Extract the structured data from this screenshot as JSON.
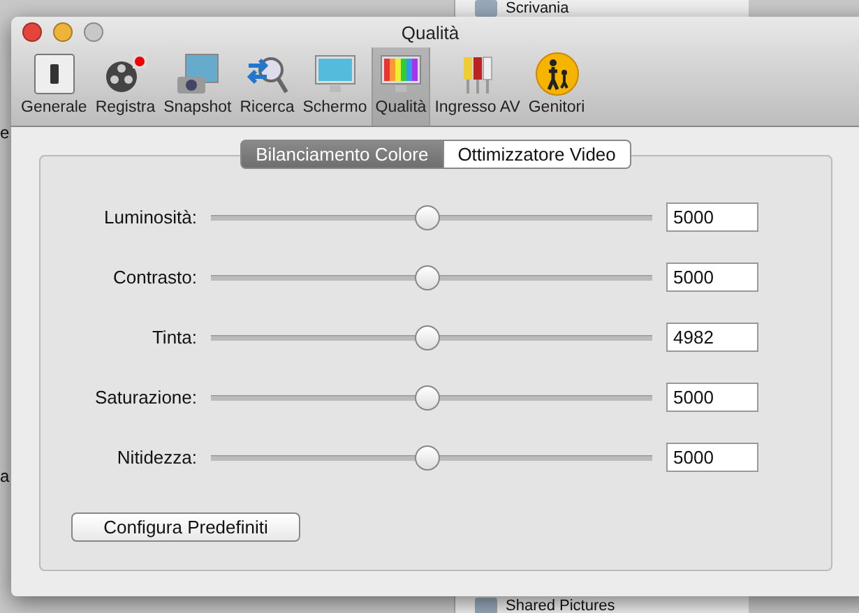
{
  "background": {
    "items": [
      "Scrivania",
      "Shared Pictures"
    ],
    "fragments": [
      "e",
      "a"
    ]
  },
  "window": {
    "title": "Qualità"
  },
  "toolbar": {
    "items": [
      {
        "label": "Generale",
        "selected": false
      },
      {
        "label": "Registra",
        "selected": false
      },
      {
        "label": "Snapshot",
        "selected": false
      },
      {
        "label": "Ricerca",
        "selected": false
      },
      {
        "label": "Schermo",
        "selected": false
      },
      {
        "label": "Qualità",
        "selected": true
      },
      {
        "label": "Ingresso AV",
        "selected": false
      },
      {
        "label": "Genitori",
        "selected": false
      }
    ]
  },
  "tabs": [
    {
      "label": "Bilanciamento Colore",
      "selected": true
    },
    {
      "label": "Ottimizzatore Video",
      "selected": false
    }
  ],
  "sliders": [
    {
      "label": "Luminosità:",
      "level": 0.49,
      "value": "5000"
    },
    {
      "label": "Contrasto:",
      "level": 0.49,
      "value": "5000"
    },
    {
      "label": "Tinta:",
      "level": 0.49,
      "value": "4982"
    },
    {
      "label": "Saturazione:",
      "level": 0.49,
      "value": "5000"
    },
    {
      "label": "Nitidezza:",
      "level": 0.49,
      "value": "5000"
    }
  ],
  "buttons": [
    "Configura Predefiniti"
  ]
}
